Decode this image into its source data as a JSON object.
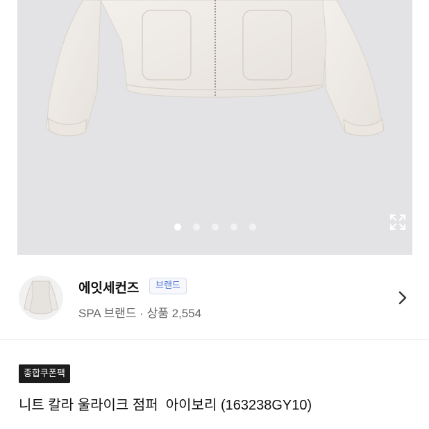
{
  "gallery": {
    "slide_count": 5,
    "active_slide": 1,
    "expand_icon": "expand-arrows-icon"
  },
  "brand": {
    "name": "에잇세컨즈",
    "badge": "브랜드",
    "subtitle": "SPA 브랜드 · 상품 2,554",
    "chevron_icon": "chevron-right-icon"
  },
  "product": {
    "coupon_tag": "종합쿠폰팩",
    "title": "니트 칼라 울라이크 점퍼  아이보리 (163238GY10)"
  },
  "colors": {
    "background": "#e3e3e5",
    "badge_text": "#4b6fd8",
    "coupon_bg": "#1c1c1c"
  }
}
